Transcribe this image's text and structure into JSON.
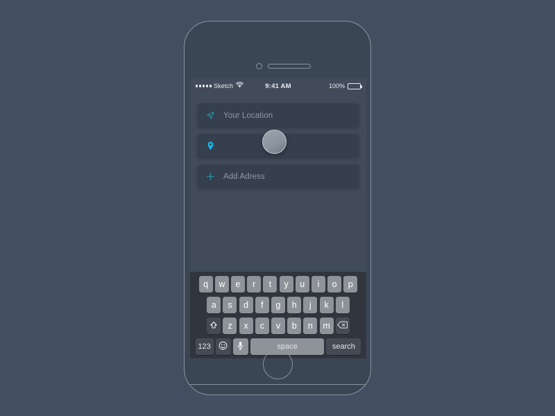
{
  "canvas": {
    "background_color": "#434f60"
  },
  "device": {
    "frame_color": "#8b949f",
    "screen_background": "#414b5a",
    "camera_icon": "camera-icon",
    "speaker_icon": "earpiece-speaker",
    "home_button": "home-button"
  },
  "status_bar": {
    "signal_dots": 5,
    "carrier": "Sketch",
    "wifi_icon": "wifi-icon",
    "time": "9:41 AM",
    "battery_percent": "100%",
    "battery_level": 100
  },
  "fields": [
    {
      "name": "your-location",
      "icon": "navigation-arrow-icon",
      "icon_color": "#2a9fb5",
      "label": "Your Location",
      "value": ""
    },
    {
      "name": "destination",
      "icon": "map-pin-icon",
      "icon_color": "#17b4e3",
      "label": "",
      "value": ""
    },
    {
      "name": "add-address",
      "icon": "plus-icon",
      "icon_color": "#2f8fa3",
      "label": "Add Adress",
      "value": ""
    }
  ],
  "touch_indicator": {
    "name": "finger-touch-circle",
    "visible": true
  },
  "keyboard": {
    "theme": "dark",
    "rows": [
      {
        "keys": [
          {
            "label": "q"
          },
          {
            "label": "w"
          },
          {
            "label": "e"
          },
          {
            "label": "r"
          },
          {
            "label": "t"
          },
          {
            "label": "y"
          },
          {
            "label": "u"
          },
          {
            "label": "i"
          },
          {
            "label": "o"
          },
          {
            "label": "p"
          }
        ]
      },
      {
        "keys": [
          {
            "label": "a"
          },
          {
            "label": "s"
          },
          {
            "label": "d"
          },
          {
            "label": "f"
          },
          {
            "label": "g"
          },
          {
            "label": "h"
          },
          {
            "label": "j"
          },
          {
            "label": "k"
          },
          {
            "label": "l"
          }
        ]
      },
      {
        "keys": [
          {
            "label": "",
            "icon": "shift-icon",
            "dark": true
          },
          {
            "label": "z"
          },
          {
            "label": "x"
          },
          {
            "label": "c"
          },
          {
            "label": "v"
          },
          {
            "label": "b"
          },
          {
            "label": "n"
          },
          {
            "label": "m"
          },
          {
            "label": "",
            "icon": "backspace-icon",
            "dark": true
          }
        ]
      },
      {
        "keys": [
          {
            "label": "123",
            "dark": true
          },
          {
            "label": "",
            "icon": "emoji-icon",
            "dark": true
          },
          {
            "label": "",
            "icon": "microphone-icon"
          },
          {
            "label": "space"
          },
          {
            "label": "search",
            "dark": true
          }
        ]
      }
    ]
  }
}
